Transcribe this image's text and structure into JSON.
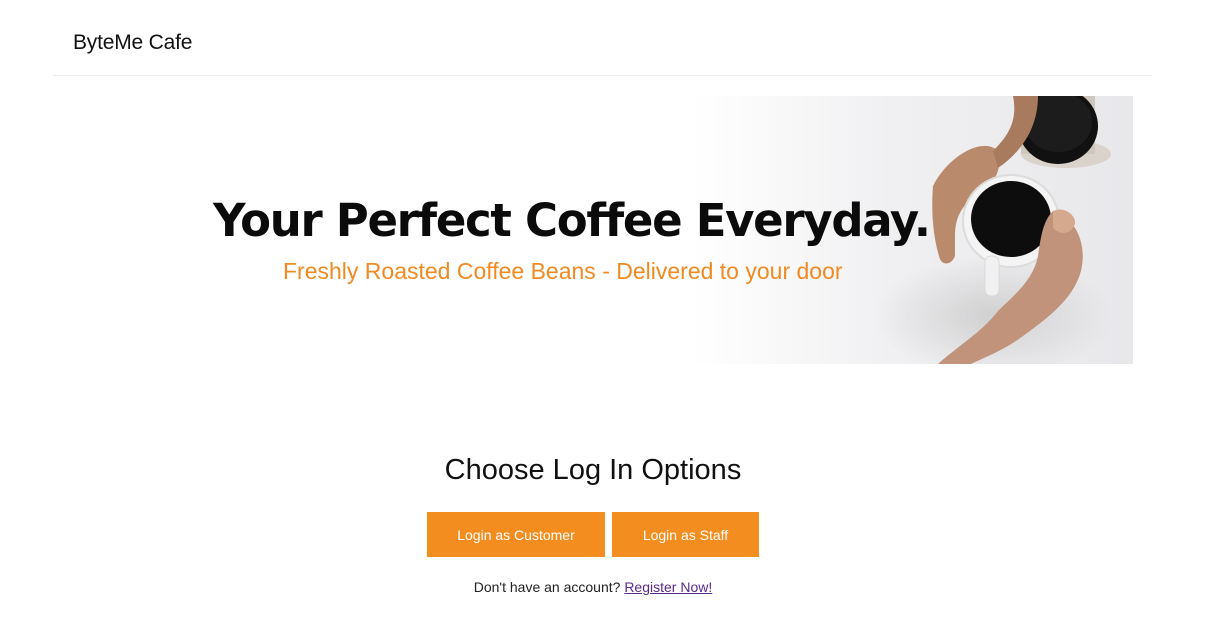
{
  "navbar": {
    "brand": "ByteMe Cafe"
  },
  "hero": {
    "title": "Your Perfect Coffee Everyday.",
    "subtitle": "Freshly Roasted Coffee Beans - Delivered to your door",
    "image_icon": "coffee-hands-image",
    "accent_color": "#f18a21"
  },
  "login": {
    "title": "Choose Log In Options",
    "customer_button": "Login as Customer",
    "staff_button": "Login as Staff",
    "button_color": "#f38d1f"
  },
  "register": {
    "prompt": "Don't have an account?",
    "link": "Register Now!"
  }
}
